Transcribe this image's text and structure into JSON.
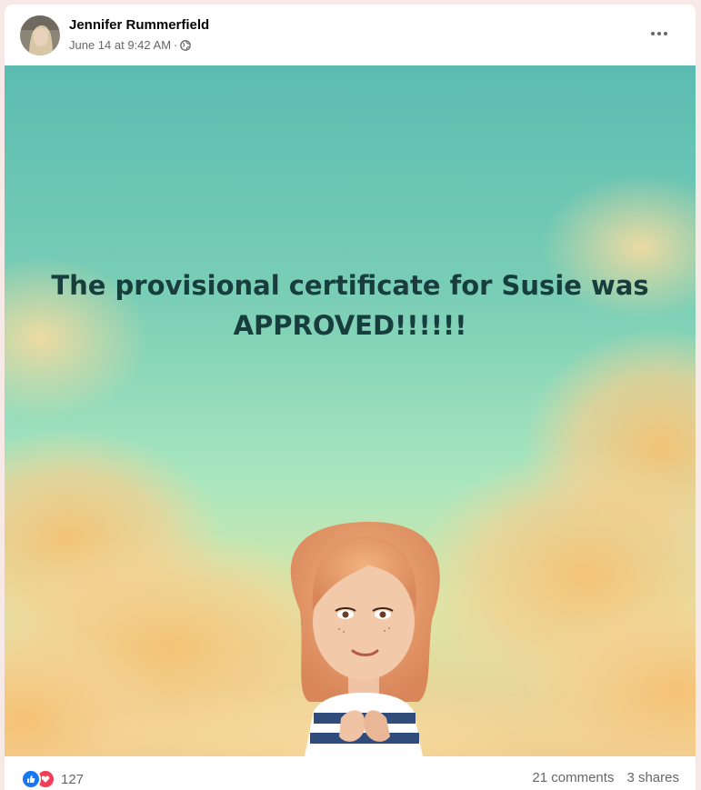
{
  "post": {
    "author": "Jennifer Rummerfield",
    "timestamp": "June 14 at 9:42 AM",
    "separator": "·",
    "privacy_icon": "globe-icon",
    "more_icon": "more-options-icon",
    "text_line1": "The provisional certificate for Susie was",
    "text_line2": "APPROVED!!!!!!"
  },
  "footer": {
    "reaction_icons": [
      "like-icon",
      "love-icon"
    ],
    "reaction_count": "127",
    "comments": "21 comments",
    "shares": "3 shares"
  },
  "colors": {
    "text_dark": "#173d3c",
    "meta_gray": "#65676b",
    "like_blue": "#1877f2",
    "love_red": "#f33e58",
    "sky_top": "#5bbcb1",
    "sky_mid": "#a9e6bf",
    "cloud": "#f3c07a"
  }
}
